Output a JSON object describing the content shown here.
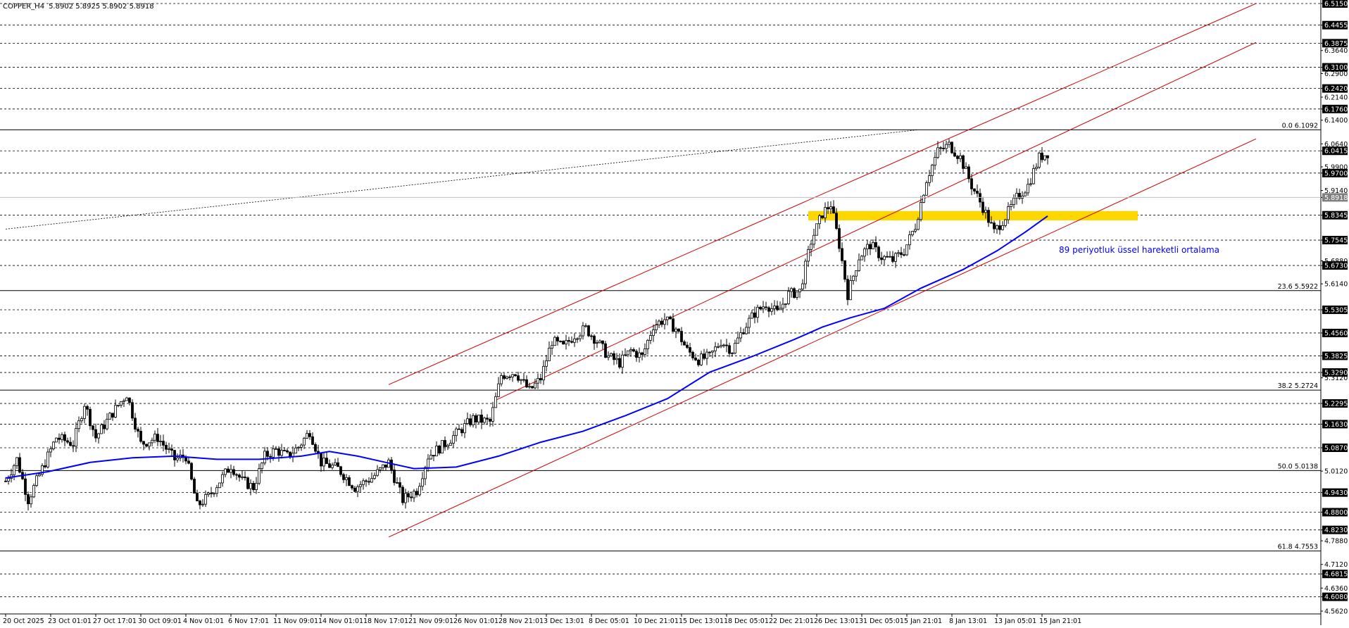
{
  "chart_data": {
    "type": "candlestick",
    "title": "COPPER_H4",
    "ohlc_header": "5.8902 5.8925 5.8902 5.8918",
    "symbol": "COPPER",
    "timeframe": "H4",
    "current_price": 5.8918,
    "ylim": [
      4.562,
      6.515
    ],
    "x_labels": [
      {
        "label": "20 Oct 2025",
        "i": 0
      },
      {
        "label": "23 Oct 01:01",
        "i": 16
      },
      {
        "label": "27 Oct 17:01",
        "i": 32
      },
      {
        "label": "30 Oct 09:01",
        "i": 48
      },
      {
        "label": "4 Nov 01:01",
        "i": 64
      },
      {
        "label": "6 Nov 17:01",
        "i": 80
      },
      {
        "label": "11 Nov 09:01",
        "i": 96
      },
      {
        "label": "14 Nov 01:01",
        "i": 112
      },
      {
        "label": "18 Nov 17:01",
        "i": 128
      },
      {
        "label": "21 Nov 09:01",
        "i": 144
      },
      {
        "label": "26 Nov 01:01",
        "i": 160
      },
      {
        "label": "28 Nov 21:01",
        "i": 176
      },
      {
        "label": "3 Dec 13:01",
        "i": 192
      },
      {
        "label": "8 Dec 05:01",
        "i": 208
      },
      {
        "label": "10 Dec 21:01",
        "i": 224
      },
      {
        "label": "15 Dec 13:01",
        "i": 240
      },
      {
        "label": "18 Dec 05:01",
        "i": 256
      },
      {
        "label": "22 Dec 21:01",
        "i": 272
      },
      {
        "label": "26 Dec 13:01",
        "i": 288
      },
      {
        "label": "31 Dec 05:01",
        "i": 304
      },
      {
        "label": "5 Jan 21:01",
        "i": 320
      },
      {
        "label": "8 Jan 13:01",
        "i": 336
      },
      {
        "label": "13 Jan 05:01",
        "i": 352
      },
      {
        "label": "15 Jan 21:01",
        "i": 368
      }
    ],
    "y_ticks": [
      "6.5150",
      "6.4455",
      "6.3875",
      "6.3640",
      "6.3100",
      "6.2900",
      "6.2420",
      "6.2140",
      "6.1760",
      "6.1400",
      "6.0640",
      "6.0415",
      "5.9900",
      "5.9700",
      "5.9140",
      "5.8918",
      "5.8345",
      "5.7545",
      "5.6880",
      "5.6730",
      "5.6140",
      "5.5305",
      "5.4560",
      "5.3825",
      "5.3290",
      "5.3120",
      "5.2295",
      "5.1630",
      "5.0870",
      "5.0120",
      "4.9430",
      "4.8800",
      "4.8230",
      "4.7880",
      "4.7120",
      "4.6815",
      "4.6360",
      "4.6080",
      "4.5620"
    ],
    "y_ticks_boxed": [
      "6.5150",
      "6.4455",
      "6.3875",
      "6.3100",
      "6.2420",
      "6.1760",
      "6.0415",
      "5.9700",
      "5.8918",
      "5.8345",
      "5.7545",
      "5.6730",
      "5.5305",
      "5.4560",
      "5.3825",
      "5.3290",
      "5.2295",
      "5.1630",
      "5.0870",
      "4.9430",
      "4.8800",
      "4.8230",
      "4.6815",
      "4.6080"
    ],
    "dashed_levels": [
      6.515,
      6.4455,
      6.3875,
      6.31,
      6.242,
      6.176,
      6.0415,
      5.97,
      5.8345,
      5.7545,
      5.673,
      5.5305,
      5.456,
      5.3825,
      5.329,
      5.2295,
      5.163,
      5.087,
      4.943,
      4.88,
      4.823,
      4.6815,
      4.608
    ],
    "fibonacci": [
      {
        "label": "0.0 6.1092",
        "price": 6.1092
      },
      {
        "label": "23.6 5.5922",
        "price": 5.5922
      },
      {
        "label": "38.2 5.2724",
        "price": 5.2724
      },
      {
        "label": "50.0 5.0138",
        "price": 5.0138
      },
      {
        "label": "61.8 4.7553",
        "price": 4.7553
      }
    ],
    "fib_trend_line": {
      "from": [
        0,
        5.79
      ],
      "to": [
        324,
        6.109
      ]
    },
    "channel": {
      "color": "#cc0000",
      "lines": [
        {
          "from": [
            136,
            5.29
          ],
          "to": [
            444,
            6.515
          ]
        },
        {
          "from": [
            136,
            4.8
          ],
          "to": [
            444,
            6.08
          ]
        },
        {
          "from": [
            174,
            5.24
          ],
          "to": [
            444,
            6.39
          ]
        }
      ]
    },
    "support_zone": {
      "i_from": 285,
      "i_to": 402,
      "top": 5.848,
      "bottom": 5.818,
      "color": "#ffd700"
    },
    "ema": {
      "label": "89 periyotluk üssel hareketli ortalama",
      "label_at": [
        374,
        5.714
      ],
      "color": "#0000ff",
      "points": [
        [
          0,
          4.99
        ],
        [
          15,
          5.01
        ],
        [
          30,
          5.04
        ],
        [
          45,
          5.055
        ],
        [
          60,
          5.06
        ],
        [
          75,
          5.05
        ],
        [
          90,
          5.05
        ],
        [
          105,
          5.06
        ],
        [
          115,
          5.075
        ],
        [
          125,
          5.06
        ],
        [
          135,
          5.04
        ],
        [
          145,
          5.02
        ],
        [
          160,
          5.025
        ],
        [
          175,
          5.06
        ],
        [
          190,
          5.105
        ],
        [
          205,
          5.14
        ],
        [
          220,
          5.19
        ],
        [
          235,
          5.245
        ],
        [
          250,
          5.33
        ],
        [
          265,
          5.38
        ],
        [
          280,
          5.435
        ],
        [
          290,
          5.475
        ],
        [
          300,
          5.505
        ],
        [
          312,
          5.535
        ],
        [
          325,
          5.6
        ],
        [
          340,
          5.66
        ],
        [
          352,
          5.72
        ],
        [
          362,
          5.78
        ],
        [
          370,
          5.832
        ]
      ]
    },
    "candle_count": 371,
    "candle_anchors": [
      [
        0,
        4.98
      ],
      [
        4,
        5.05
      ],
      [
        8,
        4.92
      ],
      [
        12,
        5.0
      ],
      [
        18,
        5.12
      ],
      [
        24,
        5.1
      ],
      [
        28,
        5.23
      ],
      [
        32,
        5.12
      ],
      [
        38,
        5.2
      ],
      [
        43,
        5.26
      ],
      [
        48,
        5.1
      ],
      [
        54,
        5.12
      ],
      [
        60,
        5.05
      ],
      [
        64,
        5.06
      ],
      [
        68,
        4.9
      ],
      [
        72,
        4.93
      ],
      [
        80,
        5.03
      ],
      [
        84,
        4.98
      ],
      [
        88,
        4.96
      ],
      [
        92,
        5.06
      ],
      [
        96,
        5.08
      ],
      [
        100,
        5.06
      ],
      [
        104,
        5.09
      ],
      [
        108,
        5.14
      ],
      [
        112,
        5.04
      ],
      [
        118,
        5.02
      ],
      [
        124,
        4.96
      ],
      [
        130,
        4.99
      ],
      [
        136,
        5.04
      ],
      [
        141,
        4.92
      ],
      [
        146,
        4.95
      ],
      [
        150,
        5.06
      ],
      [
        156,
        5.1
      ],
      [
        161,
        5.14
      ],
      [
        166,
        5.18
      ],
      [
        172,
        5.17
      ],
      [
        176,
        5.32
      ],
      [
        181,
        5.33
      ],
      [
        186,
        5.27
      ],
      [
        190,
        5.31
      ],
      [
        194,
        5.43
      ],
      [
        198,
        5.41
      ],
      [
        202,
        5.45
      ],
      [
        206,
        5.47
      ],
      [
        210,
        5.43
      ],
      [
        214,
        5.38
      ],
      [
        218,
        5.36
      ],
      [
        222,
        5.4
      ],
      [
        226,
        5.38
      ],
      [
        230,
        5.48
      ],
      [
        234,
        5.5
      ],
      [
        238,
        5.47
      ],
      [
        242,
        5.4
      ],
      [
        246,
        5.37
      ],
      [
        250,
        5.38
      ],
      [
        254,
        5.43
      ],
      [
        258,
        5.4
      ],
      [
        262,
        5.47
      ],
      [
        266,
        5.52
      ],
      [
        270,
        5.55
      ],
      [
        274,
        5.52
      ],
      [
        278,
        5.58
      ],
      [
        282,
        5.59
      ],
      [
        286,
        5.75
      ],
      [
        290,
        5.84
      ],
      [
        293,
        5.87
      ],
      [
        296,
        5.74
      ],
      [
        299,
        5.58
      ],
      [
        303,
        5.7
      ],
      [
        307,
        5.74
      ],
      [
        311,
        5.7
      ],
      [
        315,
        5.69
      ],
      [
        319,
        5.72
      ],
      [
        323,
        5.8
      ],
      [
        327,
        5.95
      ],
      [
        331,
        6.04
      ],
      [
        335,
        6.06
      ],
      [
        339,
        6.02
      ],
      [
        343,
        5.93
      ],
      [
        347,
        5.86
      ],
      [
        351,
        5.78
      ],
      [
        355,
        5.83
      ],
      [
        359,
        5.89
      ],
      [
        363,
        5.93
      ],
      [
        367,
        6.02
      ],
      [
        371,
        6.04
      ],
      [
        375,
        6.01
      ],
      [
        379,
        6.05
      ],
      [
        383,
        6.07
      ],
      [
        387,
        6.02
      ],
      [
        391,
        5.95
      ],
      [
        395,
        5.93
      ],
      [
        399,
        5.89
      ],
      [
        403,
        5.87
      ],
      [
        406,
        5.89
      ]
    ]
  }
}
